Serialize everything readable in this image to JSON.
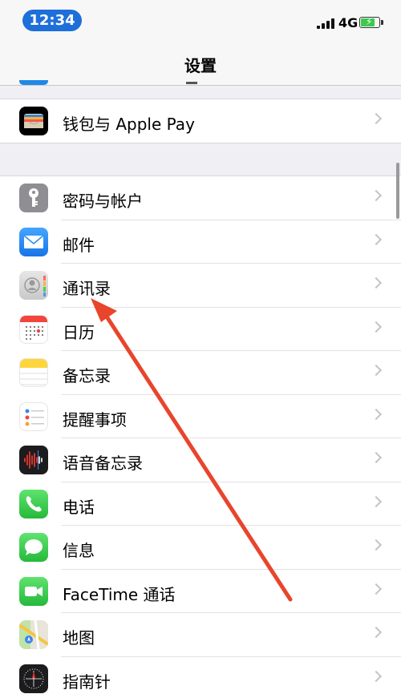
{
  "status_bar": {
    "time": "12:34",
    "network": "4G"
  },
  "nav": {
    "title": "设置"
  },
  "wallet_row": {
    "label": "钱包与 Apple Pay",
    "icon": "wallet-icon"
  },
  "settings_items": [
    {
      "label": "密码与帐户",
      "icon": "key-icon",
      "color": "#8e8e93"
    },
    {
      "label": "邮件",
      "icon": "mail-icon",
      "color": "#2a8cf0"
    },
    {
      "label": "通讯录",
      "icon": "contacts-icon",
      "color": "#cfcfcf"
    },
    {
      "label": "日历",
      "icon": "calendar-icon",
      "color": "#ffffff"
    },
    {
      "label": "备忘录",
      "icon": "notes-icon",
      "color": "#ffd53c"
    },
    {
      "label": "提醒事项",
      "icon": "reminders-icon",
      "color": "#ffffff"
    },
    {
      "label": "语音备忘录",
      "icon": "voice-memos-icon",
      "color": "#1c1c1e"
    },
    {
      "label": "电话",
      "icon": "phone-icon",
      "color": "#34c759"
    },
    {
      "label": "信息",
      "icon": "messages-icon",
      "color": "#34c759"
    },
    {
      "label": "FaceTime 通话",
      "icon": "facetime-icon",
      "color": "#34c759"
    },
    {
      "label": "地图",
      "icon": "maps-icon",
      "color": "#e8e4da"
    },
    {
      "label": "指南针",
      "icon": "compass-icon",
      "color": "#1c1c1e"
    }
  ],
  "annotation": {
    "color": "#e8452c"
  }
}
